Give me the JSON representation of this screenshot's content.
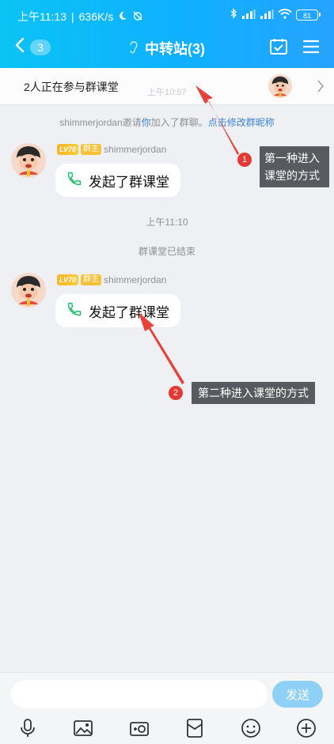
{
  "status_bar": {
    "time": "上午11:13",
    "speed": "636K/s",
    "battery": "81"
  },
  "nav": {
    "back_count": "3",
    "title": "中转站(3)"
  },
  "notice_bar": {
    "text": "2人正在参与群课堂",
    "ghost_time": "上午10:57"
  },
  "system": {
    "invite_user": "shimmerjordan",
    "invite_mid1": "邀请",
    "invite_you": "你",
    "invite_mid2": "加入了群聊。",
    "invite_link": "点击修改群昵称",
    "time_2": "上午11:10",
    "ended": "群课堂已结束"
  },
  "messages": [
    {
      "level": "LV70",
      "role": "群主",
      "sender": "shimmerjordan",
      "text": "发起了群课堂"
    },
    {
      "level": "LV70",
      "role": "群主",
      "sender": "shimmerjordan",
      "text": "发起了群课堂"
    }
  ],
  "annotations": [
    {
      "number": "1",
      "text": "第一种进入课堂的方式"
    },
    {
      "number": "2",
      "text": "第二种进入课堂的方式"
    }
  ],
  "input": {
    "value": "",
    "send_label": "发送"
  },
  "toolbar_icons": [
    "microphone-icon",
    "image-icon",
    "camera-icon",
    "red-packet-icon",
    "emoji-icon",
    "plus-icon"
  ],
  "colors": {
    "header_start": "#0bc3f4",
    "header_end": "#26a3ff",
    "send_button": "#8fd0f7",
    "callout_bg": "#575b60",
    "callout_number": "#e53935",
    "arrow": "#e8413a",
    "link": "#3a85d6",
    "level_badge": "#f7b52a"
  }
}
